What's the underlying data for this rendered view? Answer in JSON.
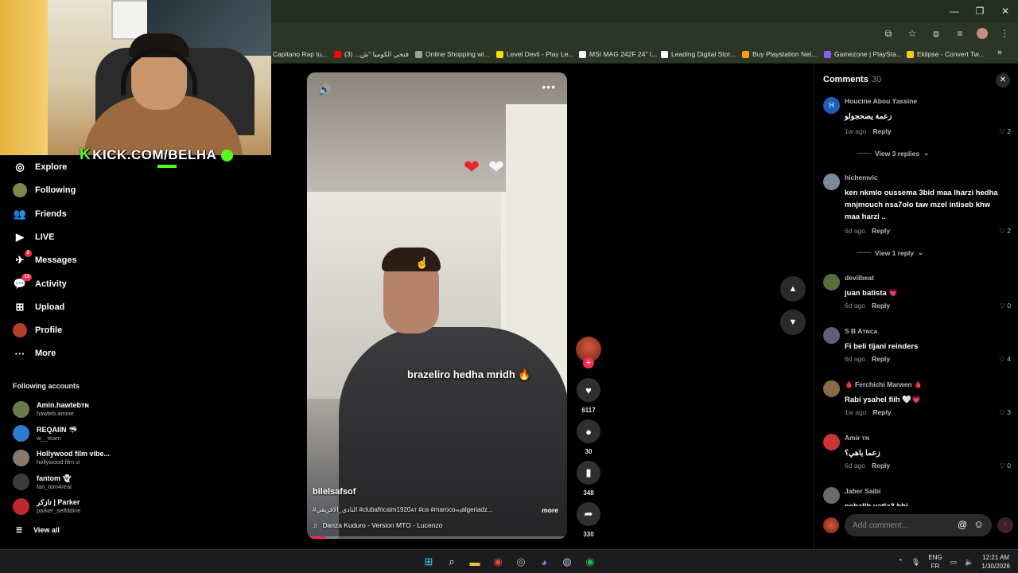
{
  "bookmarks": [
    {
      "label": "Capitano Rap tu...",
      "color": "#2b3627"
    },
    {
      "label": "فتحي الكوميا \"ش... (3)",
      "color": "#ff0000"
    },
    {
      "label": "Online Shopping wi...",
      "color": "#9aa0a6"
    },
    {
      "label": "Level Devil - Play Le...",
      "color": "#f5d90a"
    },
    {
      "label": "MSI MAG 242F 24\" I...",
      "color": "#ffffff"
    },
    {
      "label": "Leading Digital Stor...",
      "color": "#ffffff"
    },
    {
      "label": "Buy Playstation Net...",
      "color": "#f59e0b"
    },
    {
      "label": "Gamezone | PlaySta...",
      "color": "#8b5cf6"
    },
    {
      "label": "Eklipse - Convert Tw...",
      "color": "#facc15"
    }
  ],
  "overlay": {
    "kick": "KICK.COM/BELHA",
    "k_letter": "K"
  },
  "nav": [
    {
      "label": "Explore",
      "icon": "compass-icon",
      "glyph": "◎"
    },
    {
      "label": "Following",
      "icon": "following-avatar-icon",
      "glyph": "●"
    },
    {
      "label": "Friends",
      "icon": "friends-icon",
      "glyph": "👥"
    },
    {
      "label": "LIVE",
      "icon": "live-icon",
      "glyph": "▶"
    },
    {
      "label": "Messages",
      "icon": "messages-icon",
      "glyph": "✈",
      "badge": "2"
    },
    {
      "label": "Activity",
      "icon": "activity-icon",
      "glyph": "💬",
      "badge": "13"
    },
    {
      "label": "Upload",
      "icon": "upload-icon",
      "glyph": "⊞"
    },
    {
      "label": "Profile",
      "icon": "profile-avatar-icon",
      "glyph": "●"
    },
    {
      "label": "More",
      "icon": "more-icon",
      "glyph": "···"
    }
  ],
  "following_title": "Following accounts",
  "accounts": [
    {
      "name": "Amin.hawtebᴛɴ",
      "handle": "hawteb.amine",
      "color": "#6b7a4c"
    },
    {
      "name": "REQAIIN 🦈",
      "handle": "w__team",
      "color": "#2f7ad1"
    },
    {
      "name": "Hollywood film vibe...",
      "handle": "hollywood.film.vi",
      "color": "#8a7a6a"
    },
    {
      "name": "fantom 👻",
      "handle": "fan_tom4real",
      "color": "#3a3a3a"
    },
    {
      "name": "تازكر | Parker",
      "handle": "parker_selfddine",
      "color": "#c0272d"
    }
  ],
  "view_all": "View all",
  "video": {
    "overlay_text": "brazeliro hedha mridh 🔥",
    "author": "bilelsafsof",
    "description": "#النادي_الافريقي #clubafricaim1920ᴀᴛ #ca #marocoₘₐalgeriadz...",
    "more": "more",
    "music": "Danza Kuduro - Version MTO - Lucenzo",
    "progress": 0.07
  },
  "rail": {
    "likes": "6117",
    "comments": "30",
    "saves": "348",
    "shares": "330"
  },
  "comments_panel": {
    "title": "Comments",
    "count": "30",
    "placeholder": "Add comment...",
    "items": [
      {
        "user": "Houcine Abou Yassine",
        "text": "زعمة يصحجولو",
        "time": "1w ago",
        "reply": "Reply",
        "likes": "2",
        "av_letter": "H",
        "av_color": "#1f5fb8",
        "view_replies": "View 3 replies"
      },
      {
        "user": "hichemvic",
        "text": "ken nkmlo oussema 3bid maa lharzi hedha mnjmouch nsa7olo taw mzel intiseb khw maa harzi ..",
        "time": "6d ago",
        "reply": "Reply",
        "likes": "2",
        "av_letter": "",
        "av_color": "#7a8a9a",
        "view_replies": "View 1 reply"
      },
      {
        "user": "devilbeat",
        "text": "juan batista 💗",
        "time": "6d ago",
        "reply": "Reply",
        "likes": "0",
        "av_letter": "",
        "av_color": "#5c6b3a"
      },
      {
        "user": "S B Aᴛɴᴄᴀ",
        "text": "Fi beli tijani reinders",
        "time": "6d ago",
        "reply": "Reply",
        "likes": "4",
        "av_letter": "",
        "av_color": "#6a5a7a"
      },
      {
        "user": "🩸 Ferchichi Marwen 🩸",
        "text": "Rabi ysahel fiih 🤍💗",
        "time": "1w ago",
        "reply": "Reply",
        "likes": "3",
        "av_letter": "",
        "av_color": "#8a6a4a"
      },
      {
        "user": "Amir ᴛɴ",
        "text": "زعما باهي؟",
        "time": "6d ago",
        "reply": "Reply",
        "likes": "0",
        "av_letter": "",
        "av_color": "#c33"
      },
      {
        "user": "Jaber Saibi",
        "text": "nchallh yatla3 bhi",
        "time": "",
        "reply": "",
        "likes": "",
        "av_letter": "",
        "av_color": "#6a6a6a"
      }
    ]
  },
  "taskbar": {
    "lang_top": "ENG",
    "lang_bottom": "FR",
    "time": "12:21 AM",
    "date": "1/30/2026"
  }
}
